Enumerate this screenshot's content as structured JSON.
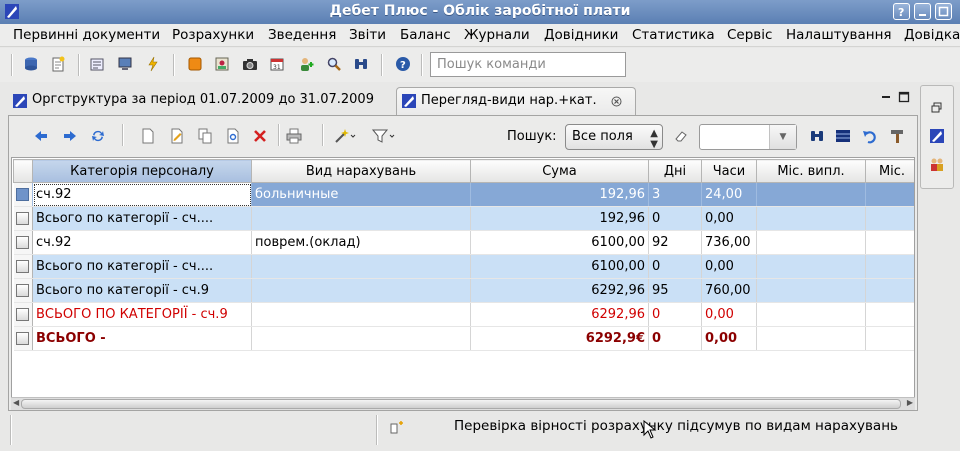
{
  "window": {
    "title": "Дебет Плюс - Облік заробітної плати"
  },
  "menu": {
    "items": [
      "Первинні документи",
      "Розрахунки",
      "Зведення",
      "Звіти",
      "Баланс",
      "Журнали",
      "Довідники",
      "Статистика",
      "Сервіс",
      "Налаштування",
      "Довідка"
    ]
  },
  "toolbar": {
    "command_placeholder": "Пошук команди"
  },
  "tabs": [
    {
      "label": "Оргструктура за період 01.07.2009 до 31.07.2009",
      "active": false
    },
    {
      "label": "Перегляд-види нар.+кат.",
      "active": true
    }
  ],
  "grid_toolbar": {
    "search_label": "Пошук:",
    "search_scope": "Все поля",
    "search_value": ""
  },
  "table": {
    "columns": [
      "Категорія персоналу",
      "Вид нарахувань",
      "Сума",
      "Дні",
      "Часи",
      "Міс. випл.",
      "Міс."
    ],
    "rows": [
      {
        "category": "сч.92",
        "kind": "больничные",
        "sum": "192,96",
        "days": "3",
        "hours": "24,00",
        "style": "selected"
      },
      {
        "category": "Всього по категорії - сч....",
        "kind": "",
        "sum": "192,96",
        "days": "0",
        "hours": "0,00",
        "style": "sub"
      },
      {
        "category": "сч.92",
        "kind": "поврем.(оклад)",
        "sum": "6100,00",
        "days": "92",
        "hours": "736,00",
        "style": "normal"
      },
      {
        "category": "Всього по категорії - сч....",
        "kind": "",
        "sum": "6100,00",
        "days": "0",
        "hours": "0,00",
        "style": "sub"
      },
      {
        "category": "Всього по категорії - сч.9",
        "kind": "",
        "sum": "6292,96",
        "days": "95",
        "hours": "760,00",
        "style": "sub"
      },
      {
        "category": "ВСЬОГО ПО КАТЕГОРІЇ - сч.9",
        "kind": "",
        "sum": "6292,96",
        "days": "0",
        "hours": "0,00",
        "style": "red"
      },
      {
        "category": "ВСЬОГО -",
        "kind": "",
        "sum": "6292,9€",
        "days": "0",
        "hours": "0,00",
        "style": "dark"
      }
    ]
  },
  "status": {
    "message": "Перевірка вірності розрахунку підсумув по видам нарахувань"
  },
  "colors": {
    "selected_row": "#86a8d6",
    "subtotal_row": "#cae0f6",
    "red_text": "#d00000",
    "dark_red_text": "#8b0000"
  }
}
